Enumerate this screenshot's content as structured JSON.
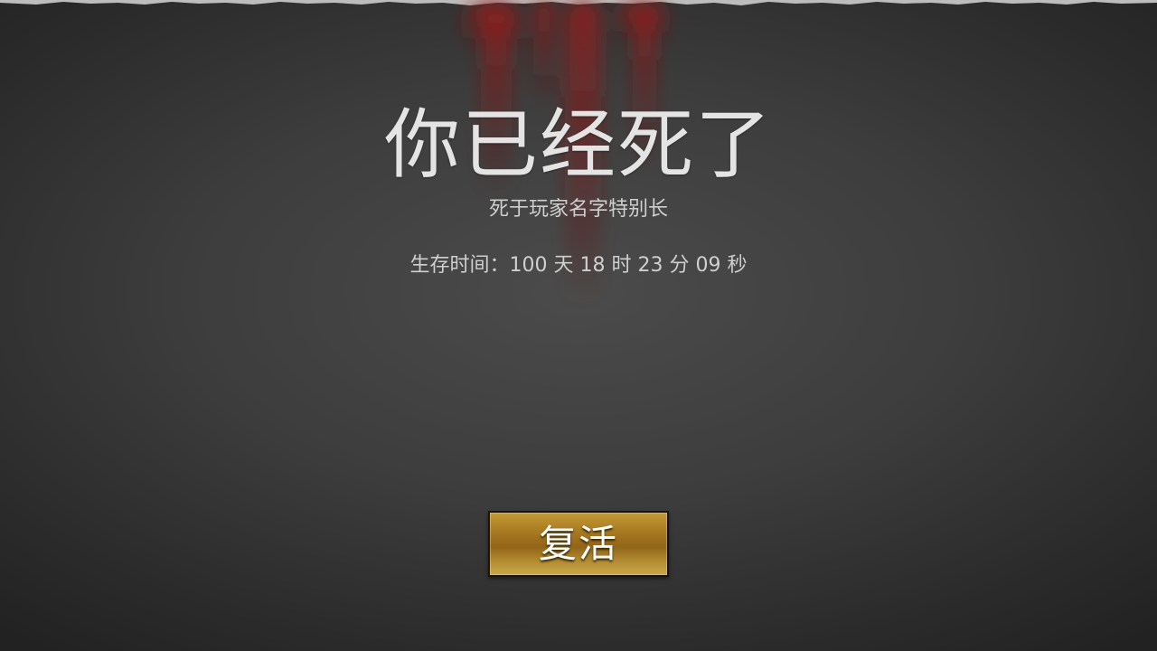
{
  "death_screen": {
    "title": "你已经死了",
    "killer_text": "死于玩家名字特别长",
    "survival_time": "生存时间：100 天 18 时 23 分 09 秒",
    "revive_label": "复活"
  },
  "colors": {
    "background": "#3d3d3d",
    "title_text": "#e4e4e4",
    "body_text": "#cfcfcf",
    "button_gold": "#a87a22",
    "blood": "#8a1c1c"
  }
}
